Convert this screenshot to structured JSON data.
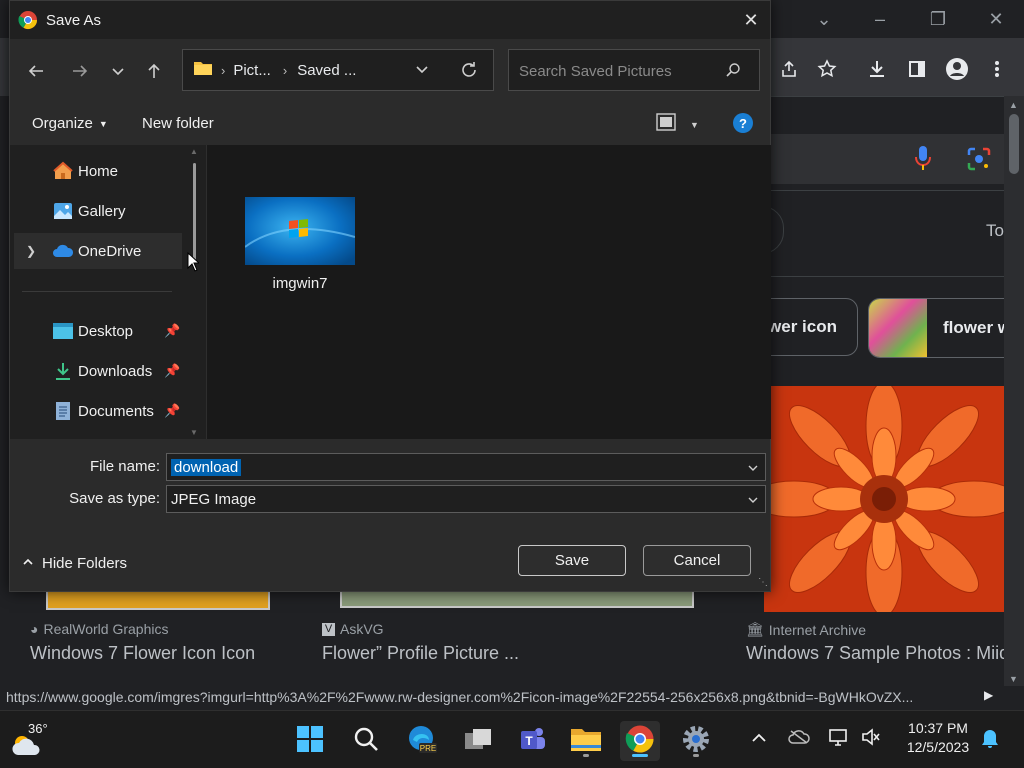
{
  "dialog": {
    "title": "Save As",
    "breadcrumb": [
      "Pict...",
      "Saved ..."
    ],
    "search_placeholder": "Search Saved Pictures",
    "organize_label": "Organize",
    "new_folder_label": "New folder",
    "nav_items": [
      {
        "label": "Home",
        "icon": "home-icon"
      },
      {
        "label": "Gallery",
        "icon": "gallery-icon"
      },
      {
        "label": "OneDrive",
        "icon": "onedrive-icon"
      },
      {
        "label": "Desktop",
        "icon": "desktop-icon",
        "pinned": true
      },
      {
        "label": "Downloads",
        "icon": "download-icon",
        "pinned": true
      },
      {
        "label": "Documents",
        "icon": "documents-icon",
        "pinned": true
      }
    ],
    "files": [
      {
        "name": "imgwin7"
      }
    ],
    "file_name_label": "File name:",
    "file_name_value": "download",
    "save_type_label": "Save as type:",
    "save_type_value": "JPEG Image",
    "hide_folders_label": "Hide Folders",
    "save_button": "Save",
    "cancel_button": "Cancel"
  },
  "browser": {
    "chips": [
      "wer icon",
      "flower w"
    ],
    "side_text": "To",
    "results": [
      {
        "source": "RealWorld Graphics",
        "title": "Windows 7 Flower Icon Icon"
      },
      {
        "source": "AskVG",
        "title": "Flower” Profile Picture ..."
      },
      {
        "source": "Internet Archive",
        "title": "Windows 7 Sample Photos : Miid"
      }
    ],
    "status_url": "https://www.google.com/imgres?imgurl=http%3A%2F%2Fwww.rw-designer.com%2Ficon-image%2F22554-256x256x8.png&tbnid=-BgWHkOvZX..."
  },
  "taskbar": {
    "weather_temp": "36°",
    "time": "10:37 PM",
    "date": "12/5/2023",
    "apps": [
      "windows-start",
      "search",
      "edge-pre",
      "task-view",
      "teams",
      "file-explorer",
      "chrome",
      "settings"
    ]
  },
  "colors": {
    "accent": "#0078d4",
    "selection": "#0063b1",
    "flower": "#e8481c"
  }
}
